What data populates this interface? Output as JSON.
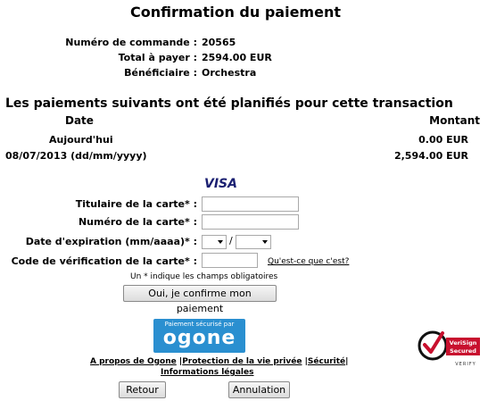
{
  "header": {
    "title": "Confirmation du paiement"
  },
  "order": {
    "order_number_label": "Numéro de commande :",
    "order_number_value": "20565",
    "total_label": "Total à payer :",
    "total_value": "2594.00 EUR",
    "beneficiary_label": "Bénéficiaire :",
    "beneficiary_value": "Orchestra"
  },
  "schedule": {
    "title": "Les paiements suivants ont été planifiés pour cette transaction",
    "date_header": "Date",
    "amount_header": "Montant",
    "rows": [
      {
        "date": "Aujourd'hui",
        "amount": "0.00 EUR"
      },
      {
        "date": "08/07/2013 (dd/mm/yyyy)",
        "amount": "2,594.00 EUR"
      }
    ]
  },
  "card_form": {
    "brand": "VISA",
    "holder_label": "Titulaire de la carte* :",
    "holder_value": "",
    "number_label": "Numéro de la carte* :",
    "number_value": "",
    "expiry_label": "Date d'expiration (mm/aaaa)* :",
    "expiry_month": "",
    "expiry_separator": "/",
    "expiry_year": "",
    "cvc_label": "Code de vérification de la carte* :",
    "cvc_value": "",
    "cvc_help_link": "Qu'est-ce que c'est?",
    "required_note": "Un * indique les champs obligatoires",
    "confirm_button": "Oui, je confirme mon paiement"
  },
  "footer": {
    "ogone_badge_small": "Paiement sécurisé par",
    "ogone_badge_big": "ogone",
    "links": [
      "A propos de Ogone",
      "Protection de la vie privée",
      "Sécurité",
      "Informations légales"
    ],
    "back_button": "Retour",
    "cancel_button": "Annulation",
    "verisign_line1": "VeriSign",
    "verisign_line2": "Secured",
    "verisign_line3": "VERIFY"
  }
}
